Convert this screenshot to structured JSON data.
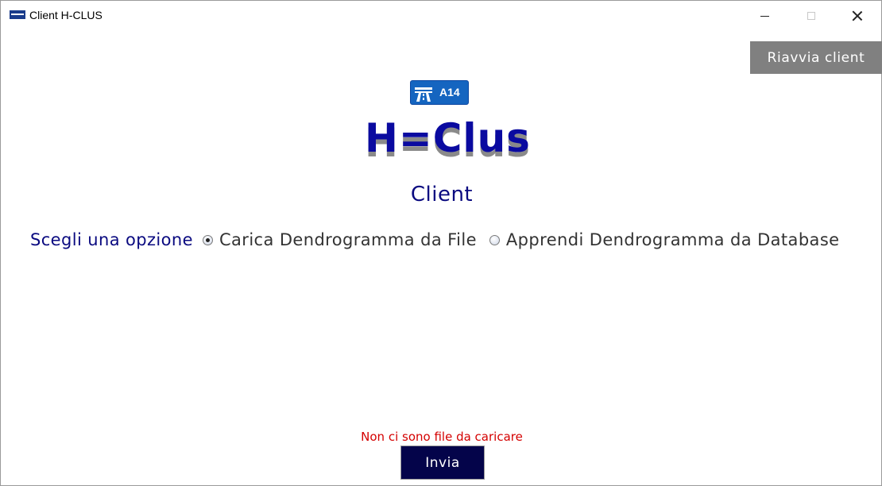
{
  "window": {
    "title": "Client H-CLUS",
    "controls": [
      "minimize-icon",
      "maximize-icon",
      "close-icon"
    ]
  },
  "header": {
    "restart_label": "Riavvia client",
    "sign_text": "A14",
    "logo_text": "H=Clus",
    "subtitle": "Client"
  },
  "options": {
    "prompt": "Scegli una opzione",
    "choices": [
      {
        "label": "Carica Dendrogramma da File",
        "selected": true
      },
      {
        "label": "Apprendi Dendrogramma da Database",
        "selected": false
      }
    ]
  },
  "footer": {
    "status_message": "Non ci sono file da caricare",
    "submit_label": "Invia"
  },
  "colors": {
    "brand_blue": "#0a0aa0",
    "text_navy": "#0a0a80",
    "restart_bg": "#808080",
    "submit_bg": "#04044a",
    "error": "#d40000",
    "sign_bg": "#1565c0"
  }
}
